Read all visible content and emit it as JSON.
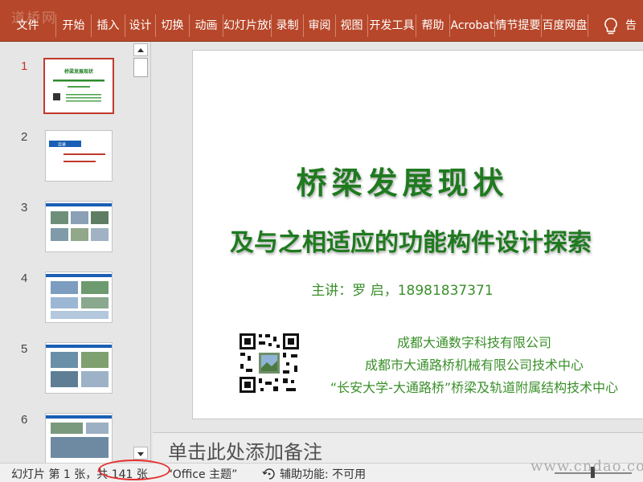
{
  "ribbon": {
    "watermark": "道桥网",
    "tabs": [
      "文件",
      "开始",
      "插入",
      "设计",
      "切换",
      "动画",
      "幻灯片放映",
      "录制",
      "审阅",
      "视图",
      "开发工具",
      "帮助",
      "Acrobat",
      "情节提要",
      "百度网盘"
    ],
    "tell_me": "告诉我",
    "bulb_icon": "lightbulb-icon"
  },
  "thumbnails": {
    "numbers": [
      "1",
      "2",
      "3",
      "4",
      "5",
      "6"
    ],
    "active_index": 0,
    "slide1_title": "桥梁发展现状",
    "slide2_label": "目录"
  },
  "slide": {
    "title": "桥梁发展现状",
    "subtitle": "及与之相适应的功能构件设计探索",
    "speaker": "主讲：罗  启，18981837371",
    "orgs": [
      "成都大通数字科技有限公司",
      "成都市大通路桥机械有限公司技术中心",
      "“长安大学-大通路桥”桥梁及轨道附属结构技术中心"
    ]
  },
  "notes": {
    "placeholder": "单击此处添加备注"
  },
  "status": {
    "slide_info": "幻灯片 第 1 张，共 141 张",
    "theme": "“Office 主题”",
    "accessibility": "辅助功能: 不可用",
    "watermark": "www.cndao.com"
  },
  "colors": {
    "accent": "#b7472a",
    "title_green": "#1f7a1f",
    "text_green": "#3a8f2a",
    "highlight_circle": "#e53030"
  }
}
